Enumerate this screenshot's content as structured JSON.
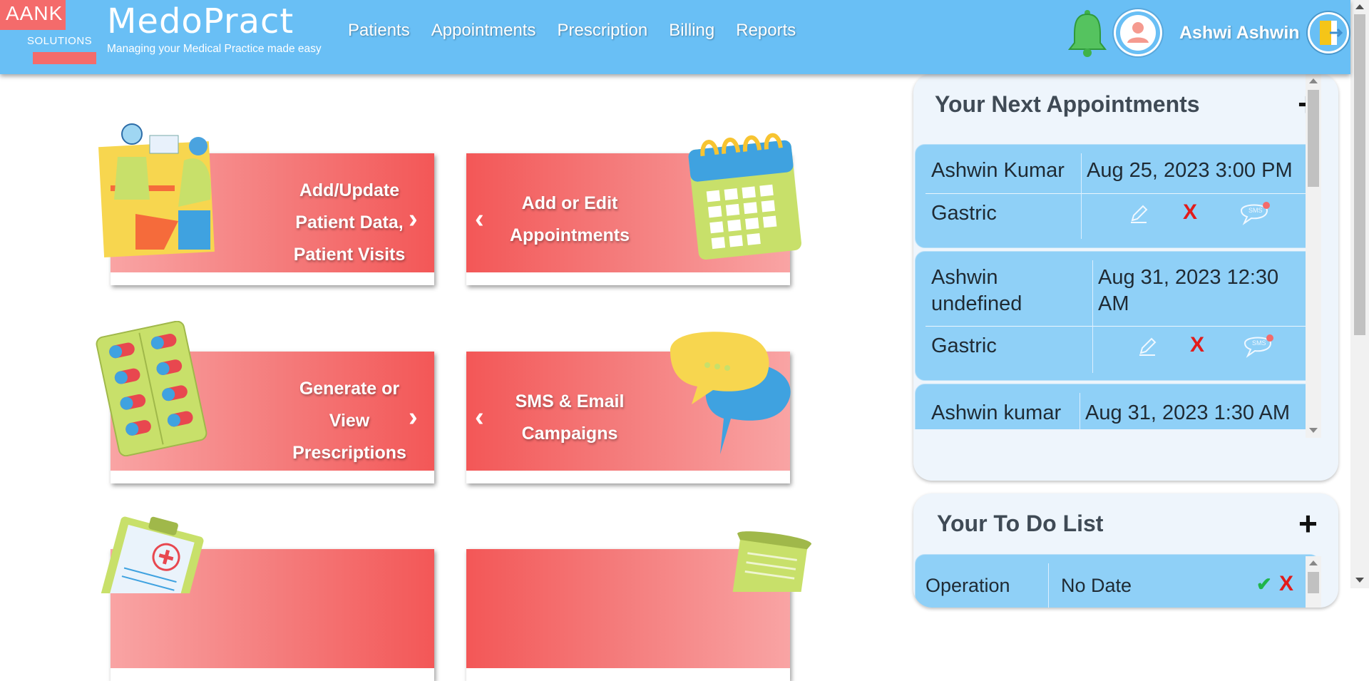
{
  "logo": {
    "top": "AANK",
    "bottom": "SOLUTIONS"
  },
  "brand": {
    "title": "MedoPract",
    "tagline": "Managing your Medical Practice made easy"
  },
  "nav": [
    "Patients",
    "Appointments",
    "Prescription",
    "Billing",
    "Reports"
  ],
  "user": {
    "name": "Ashwi  Ashwin"
  },
  "tiles": {
    "patients": [
      "Add/Update",
      "Patient Data,",
      "Patient Visits"
    ],
    "appointments": [
      "Add or Edit",
      "Appointments"
    ],
    "prescriptions": [
      "Generate or",
      "View",
      "Prescriptions"
    ],
    "campaigns": [
      "SMS & Email",
      "Campaigns"
    ]
  },
  "appointments_panel": {
    "title": "Your Next Appointments",
    "add_symbol": "+",
    "items": [
      {
        "name": "Ashwin Kumar",
        "datetime": "Aug 25, 2023 3:00 PM",
        "reason": "Gastric"
      },
      {
        "name_line1": "Ashwin",
        "name_line2": "undefined",
        "datetime_line1": "Aug 31, 2023 12:30",
        "datetime_line2": "AM",
        "reason": "Gastric"
      },
      {
        "name": "Ashwin kumar",
        "datetime": "Aug 31, 2023 1:30 AM"
      }
    ],
    "delete_symbol": "X",
    "sms_label": "SMS"
  },
  "todo_panel": {
    "title": "Your To Do List",
    "add_symbol": "+",
    "items": [
      {
        "task": "Operation",
        "date": "No Date"
      }
    ],
    "done_symbol": "✔",
    "delete_symbol": "X"
  },
  "colors": {
    "header": "#69bff5",
    "tile_red": "#f35757",
    "card_blue": "#8fd0f7",
    "delete_red": "#e21b1b"
  }
}
